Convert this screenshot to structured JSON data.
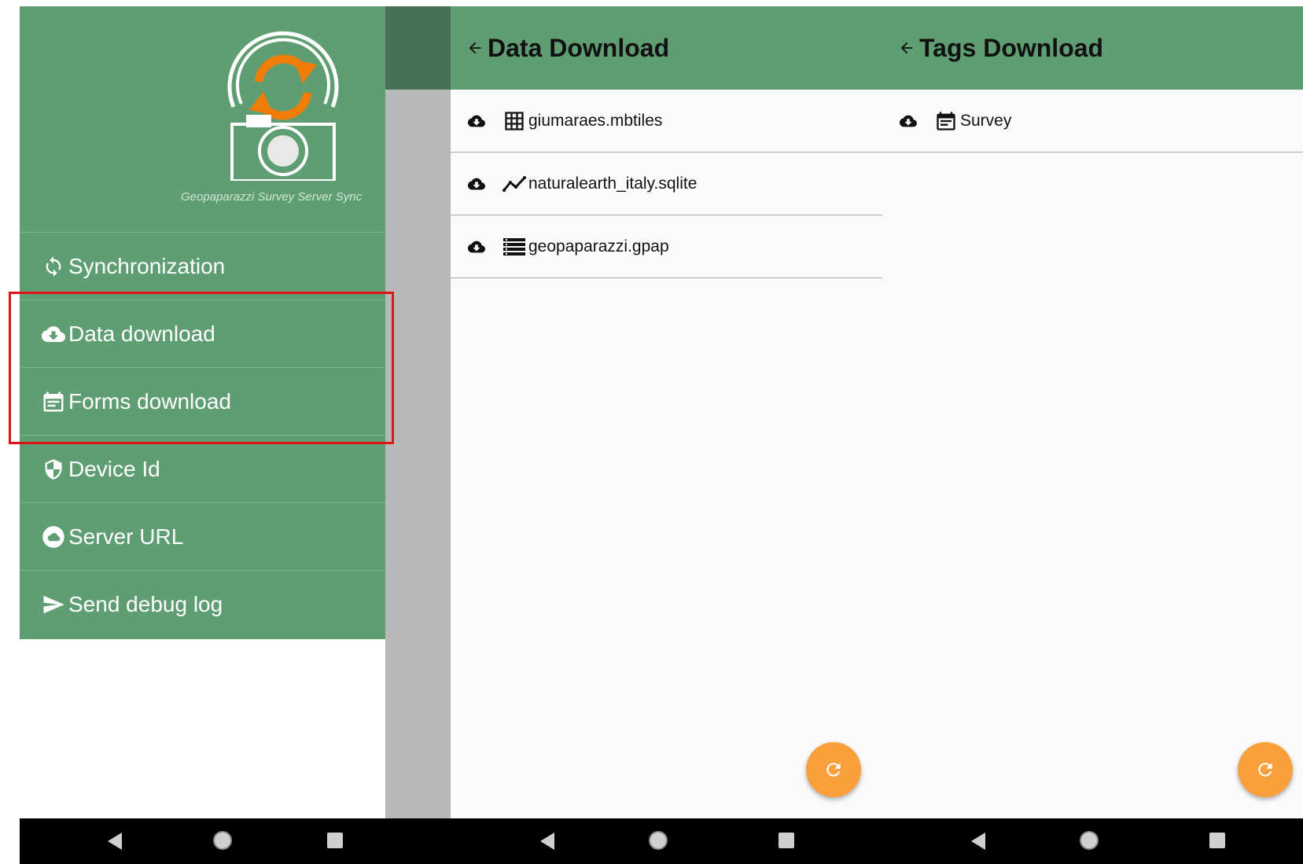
{
  "drawer": {
    "caption": "Geopaparazzi Survey Server Sync",
    "items": [
      {
        "label": "Synchronization",
        "icon": "sync-icon"
      },
      {
        "label": "Data download",
        "icon": "cloud-download-icon"
      },
      {
        "label": "Forms download",
        "icon": "form-icon"
      },
      {
        "label": "Device Id",
        "icon": "shield-icon"
      },
      {
        "label": "Server URL",
        "icon": "cloud-icon"
      },
      {
        "label": "Send debug log",
        "icon": "send-icon"
      }
    ]
  },
  "data_download": {
    "title": "Data Download",
    "items": [
      {
        "label": "giumaraes.mbtiles",
        "icon": "grid-icon"
      },
      {
        "label": "naturalearth_italy.sqlite",
        "icon": "line-chart-icon"
      },
      {
        "label": "geopaparazzi.gpap",
        "icon": "list-icon"
      }
    ]
  },
  "tags_download": {
    "title": "Tags Download",
    "items": [
      {
        "label": "Survey",
        "icon": "form-icon"
      }
    ]
  },
  "colors": {
    "primary": "#5f9e73",
    "primary_dark": "#467158",
    "accent": "#f9a03c",
    "highlight": "#e01414"
  }
}
